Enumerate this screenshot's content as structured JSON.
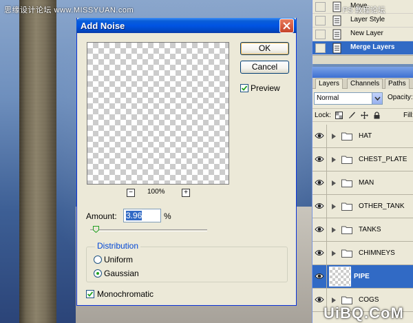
{
  "watermarks": {
    "top_left": "思缘设计论坛 www.MISSYUAN.com",
    "top_right": "PS 教程论坛",
    "bottom_right": "UiBQ.CoM"
  },
  "dialog": {
    "title": "Add Noise",
    "ok_label": "OK",
    "cancel_label": "Cancel",
    "preview_label": "Preview",
    "preview_checked": true,
    "zoom_level": "100%",
    "zoom_out_symbol": "−",
    "zoom_in_symbol": "+",
    "amount_label": "Amount:",
    "amount_value": "3.96",
    "amount_unit": "%",
    "amount_fraction": 0.0099,
    "distribution_label": "Distribution",
    "uniform_label": "Uniform",
    "gaussian_label": "Gaussian",
    "selected_distribution": "Gaussian",
    "monochromatic_label": "Monochromatic",
    "monochromatic_checked": true
  },
  "history": {
    "items": [
      {
        "label": "Move",
        "icon": "history-state-icon",
        "active": false
      },
      {
        "label": "Layer Style",
        "icon": "history-state-icon",
        "active": false
      },
      {
        "label": "New Layer",
        "icon": "history-state-icon",
        "active": false
      },
      {
        "label": "Merge Layers",
        "icon": "history-state-icon",
        "active": true
      }
    ]
  },
  "layers_panel": {
    "tabs": [
      "Layers",
      "Channels",
      "Paths"
    ],
    "active_tab": "Layers",
    "blend_mode": "Normal",
    "opacity_label": "Opacity:",
    "lock_label": "Lock:",
    "fill_label": "Fill:",
    "layers": [
      {
        "name": "HAT",
        "type": "group"
      },
      {
        "name": "CHEST_PLATE",
        "type": "group"
      },
      {
        "name": "MAN",
        "type": "group"
      },
      {
        "name": "OTHER_TANK",
        "type": "group"
      },
      {
        "name": "TANKS",
        "type": "group"
      },
      {
        "name": "CHIMNEYS",
        "type": "group"
      },
      {
        "name": "PIPE",
        "type": "layer",
        "selected": true
      },
      {
        "name": "COGS",
        "type": "group"
      }
    ]
  },
  "colors": {
    "titlebar": "#0054e3",
    "selection": "#316ac5",
    "dialog_bg": "#ece9d8"
  }
}
